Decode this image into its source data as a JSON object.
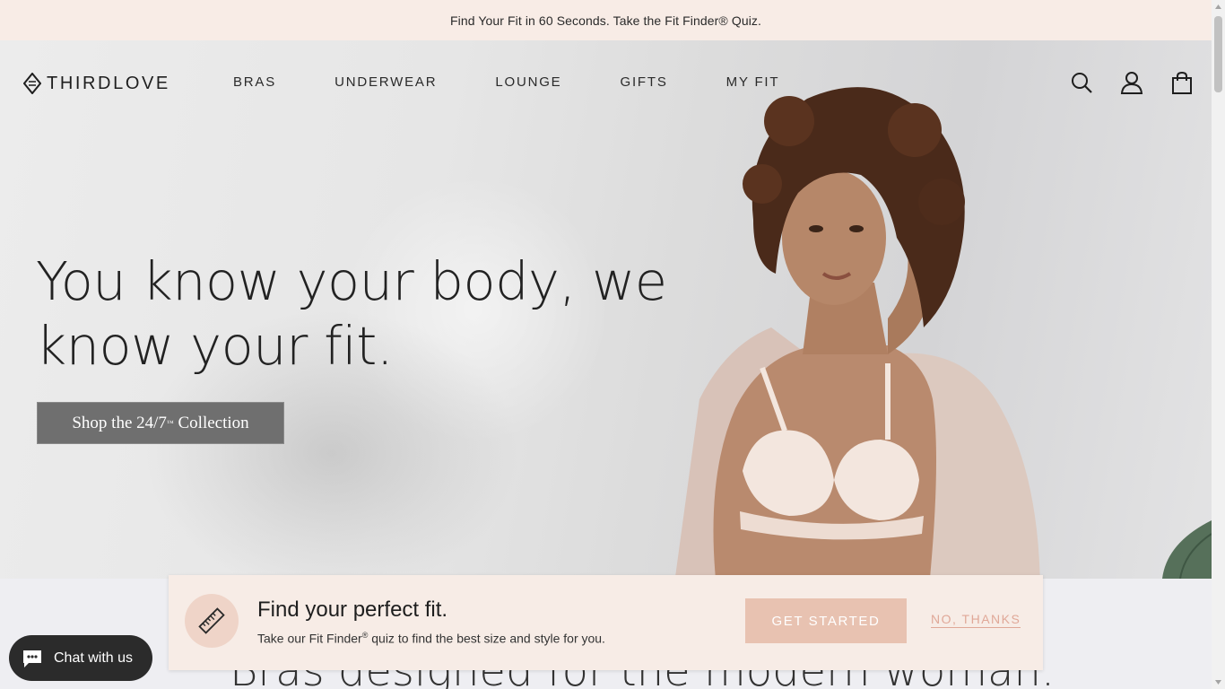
{
  "promo": {
    "text": "Find Your Fit in 60 Seconds. Take the Fit Finder® Quiz."
  },
  "header": {
    "logo_text": "THIRDLOVE",
    "nav": [
      "BRAS",
      "UNDERWEAR",
      "LOUNGE",
      "GIFTS",
      "MY FIT"
    ],
    "icons": [
      "search-icon",
      "account-icon",
      "shopping-bag-icon"
    ]
  },
  "hero": {
    "headline_line1": "You know your body, we",
    "headline_line2": "know your fit.",
    "cta_prefix": "Shop the 24/7",
    "cta_tm": "™",
    "cta_suffix": " Collection"
  },
  "below": {
    "title": "Bras designed for the modern woman."
  },
  "fit_popup": {
    "title": "Find your perfect fit.",
    "subtitle_prefix": "Take our Fit Finder",
    "subtitle_reg": "®",
    "subtitle_suffix": " quiz to find the best size and style for you.",
    "primary_label": "GET STARTED",
    "secondary_label": "NO, THANKS",
    "icon": "ruler-icon"
  },
  "chat": {
    "label": "Chat with us",
    "icon": "chat-bubble-icon"
  },
  "colors": {
    "promo_bg": "#f8ece6",
    "popup_bg": "#f7ece6",
    "accent": "#e8c2b1",
    "cta_bg": "#6f6f6f"
  }
}
